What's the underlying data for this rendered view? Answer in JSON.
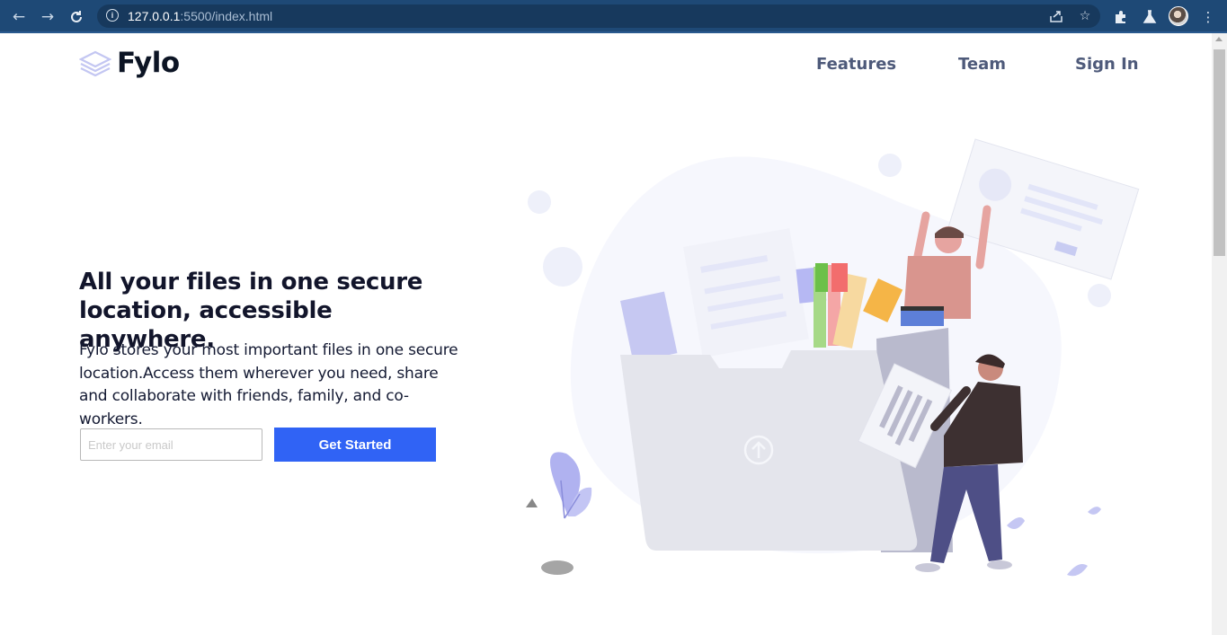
{
  "browser": {
    "url_host": "127.0.0.1",
    "url_rest": ":5500/index.html"
  },
  "header": {
    "logo_text": "Fylo",
    "nav": [
      {
        "label": "Features"
      },
      {
        "label": "Team"
      },
      {
        "label": "Sign In"
      }
    ]
  },
  "hero": {
    "title": "All your files in one secure location, accessible anywhere.",
    "description": "Fylo stores your most important files in one secure location.Access them wherever you need, share and collaborate with friends, family, and co-workers.",
    "email_placeholder": "Enter your email",
    "cta_label": "Get Started"
  },
  "colors": {
    "chrome": "#1e4976",
    "accent": "#3063f5",
    "heading": "#12152b",
    "nav": "#4e5a7a"
  },
  "icons": [
    "back-arrow-icon",
    "forward-arrow-icon",
    "reload-icon",
    "info-icon",
    "share-icon",
    "bookmark-star-icon",
    "extensions-icon",
    "labs-icon",
    "more-menu-icon",
    "logo-layers-icon",
    "upload-icon"
  ]
}
